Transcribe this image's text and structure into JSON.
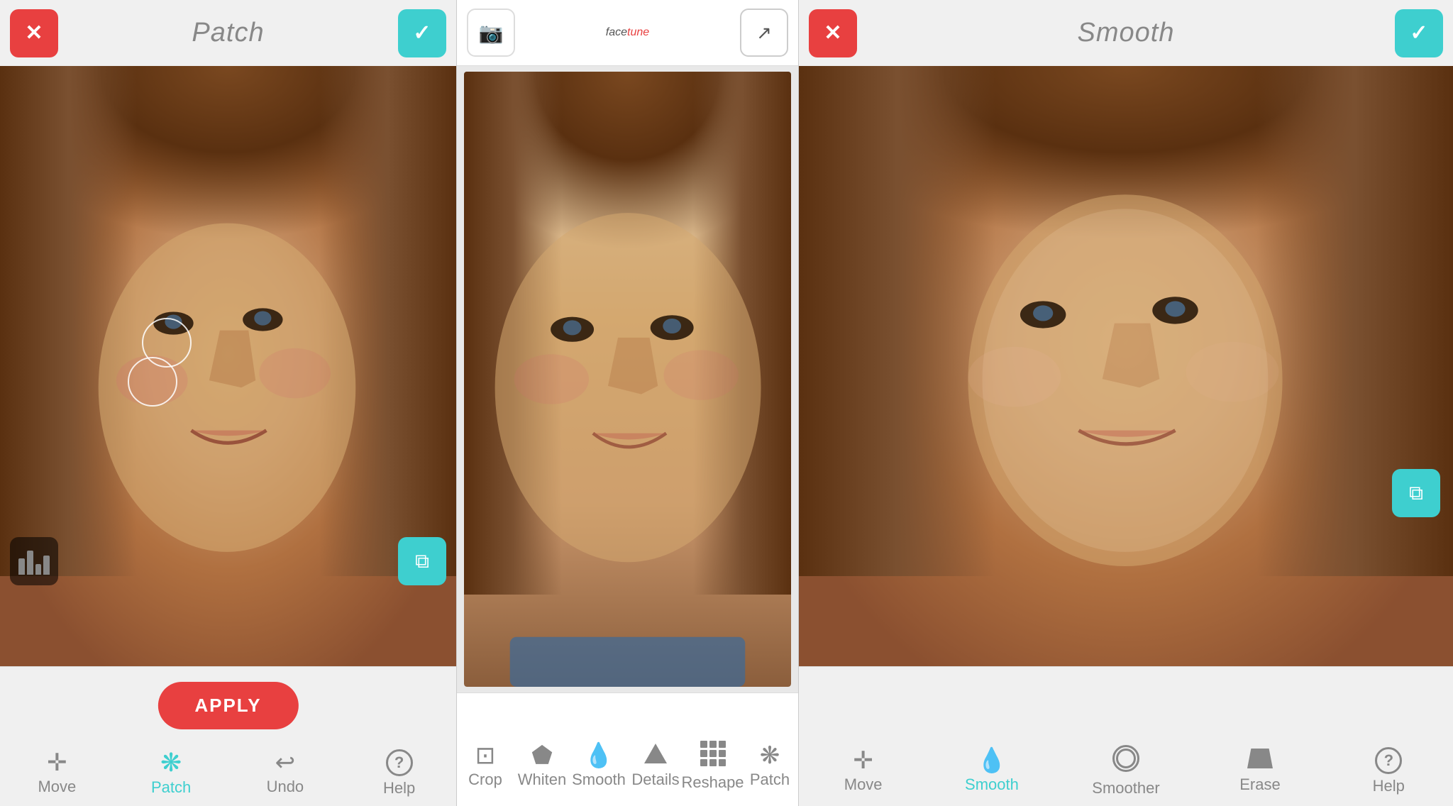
{
  "left_panel": {
    "header": {
      "cancel_label": "✕",
      "title": "Patch",
      "confirm_label": "✓"
    },
    "toolbar": {
      "apply_label": "APPLY",
      "items": [
        {
          "id": "move",
          "label": "Move",
          "active": false
        },
        {
          "id": "patch",
          "label": "Patch",
          "active": true
        },
        {
          "id": "undo",
          "label": "Undo",
          "active": false
        },
        {
          "id": "help",
          "label": "Help",
          "active": false
        }
      ]
    }
  },
  "center_panel": {
    "header": {
      "logo_face": "face",
      "logo_tune": "tune",
      "logo_full": "facetune"
    },
    "toolbar": {
      "items": [
        {
          "id": "crop",
          "label": "Crop",
          "active": false
        },
        {
          "id": "whiten",
          "label": "Whiten",
          "active": false
        },
        {
          "id": "smooth",
          "label": "Smooth",
          "active": false
        },
        {
          "id": "details",
          "label": "Details",
          "active": false
        },
        {
          "id": "reshape",
          "label": "Reshape",
          "active": false
        },
        {
          "id": "patch",
          "label": "Patch",
          "active": false
        }
      ]
    }
  },
  "right_panel": {
    "header": {
      "cancel_label": "✕",
      "title": "Smooth",
      "confirm_label": "✓"
    },
    "toolbar": {
      "items": [
        {
          "id": "move",
          "label": "Move",
          "active": false
        },
        {
          "id": "smooth",
          "label": "Smooth",
          "active": true
        },
        {
          "id": "smoother",
          "label": "Smoother",
          "active": false
        },
        {
          "id": "erase",
          "label": "Erase",
          "active": false
        },
        {
          "id": "help",
          "label": "Help",
          "active": false
        }
      ]
    }
  },
  "colors": {
    "red": "#e84040",
    "teal": "#3ecfcf",
    "gray": "#888888",
    "toolbar_bg": "#f0f0f0",
    "dark_bg": "#1a1a1a"
  }
}
